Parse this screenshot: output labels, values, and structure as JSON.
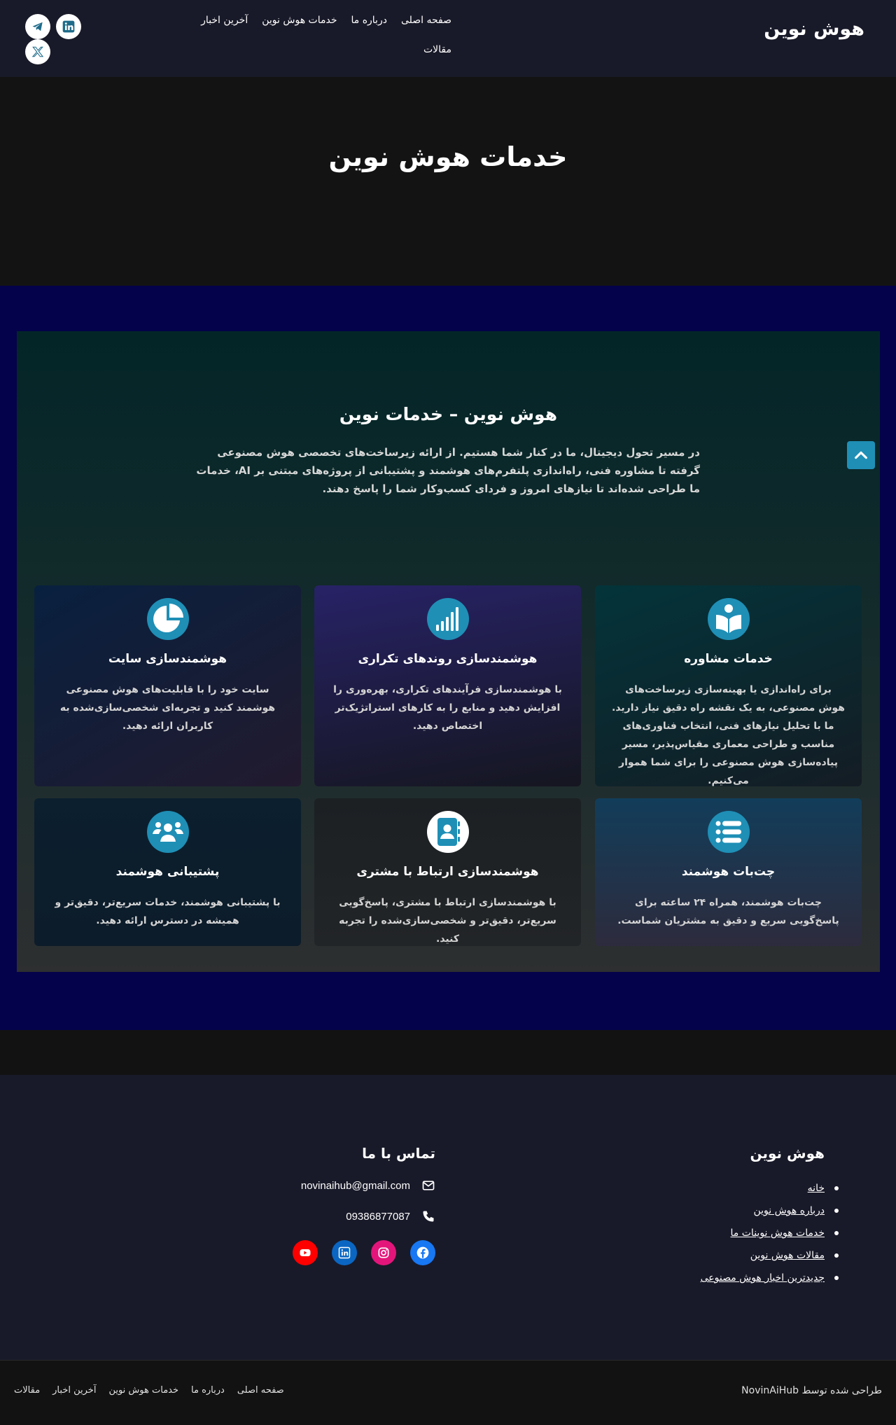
{
  "header": {
    "logo": "هوش نوین",
    "nav": [
      "صفحه اصلی",
      "درباره ما",
      "خدمات هوش نوین",
      "آخرین اخبار",
      "مقالات"
    ],
    "social_icons": [
      "telegram-icon",
      "linkedin-icon",
      "x-twitter-icon"
    ]
  },
  "hero": {
    "title": "خدمات هوش نوین"
  },
  "services": {
    "title": "هوش نوین – خدمات نوین",
    "intro": "در مسیر تحول دیجیتال، ما در کنار شما هستیم. از ارائه زیرساخت‌های تخصصی هوش مصنوعی گرفته تا مشاوره فنی، راه‌اندازی پلتفرم‌های هوشمند و پشتیبانی از پروژه‌های مبتنی بر AI، خدمات ما طراحی شده‌اند تا نیازهای امروز و فردای کسب‌وکار شما را پاسخ دهند.",
    "cards": [
      {
        "icon": "book-reader-icon",
        "title": "خدمات مشاوره",
        "text": "برای راه‌اندازی یا بهینه‌سازی زیرساخت‌های هوش مصنوعی، به یک نقشه راه دقیق نیاز دارید. ما با تحلیل نیازهای فنی، انتخاب فناوری‌های مناسب و طراحی معماری مقیاس‌پذیر، مسیر پیاده‌سازی هوش مصنوعی را برای شما هموار می‌کنیم."
      },
      {
        "icon": "signal-bars-icon",
        "title": "هوشمندسازی روندهای تکراری",
        "text": "با هوشمندسازی فرآیندهای تکراری، بهره‌وری را افزایش دهید و منابع را به کارهای استراتژیک‌تر اختصاص دهید."
      },
      {
        "icon": "pie-chart-icon",
        "title": "هوشمندسازی سایت",
        "text": "سایت خود را با قابلیت‌های هوش مصنوعی هوشمند کنید و تجربه‌ای شخصی‌سازی‌شده به کاربران ارائه دهید."
      },
      {
        "icon": "list-icon",
        "title": "چت‌بات هوشمند",
        "text": "چت‌بات هوشمند، همراه ۲۴ ساعته برای پاسخ‌گویی سریع و دقیق به مشتریان شماست."
      },
      {
        "icon": "address-book-icon",
        "title": "هوشمندسازی ارتباط با مشتری",
        "text": "با هوشمندسازی ارتباط با مشتری، پاسخ‌گویی سریع‌تر، دقیق‌تر و شخصی‌سازی‌شده را تجربه کنید."
      },
      {
        "icon": "users-icon",
        "title": "پشتیبانی هوشمند",
        "text": "با پشتیبانی هوشمند، خدمات سریع‌تر، دقیق‌تر و همیشه در دسترس ارائه دهید."
      }
    ]
  },
  "footer": {
    "brand": "هوش نوین",
    "links": [
      "خانه",
      "درباره هوش نوین",
      "خدمات هوش نوینات ما",
      "مقالات هوش نوین",
      "جدیدترین اخبار هوش مصنوعی"
    ],
    "contact_title": "تماس با ما",
    "email": "novinaihub@gmail.com",
    "phone": "09386877087",
    "social_icons": [
      "facebook-icon",
      "instagram-icon",
      "linkedin-icon",
      "youtube-icon"
    ]
  },
  "bottom_bar": {
    "credit": "طراحی شده توسط NovinAiHub",
    "nav": [
      "صفحه اصلی",
      "درباره ما",
      "خدمات هوش نوین",
      "آخرین اخبار",
      "مقالات"
    ]
  },
  "colors": {
    "header_bg": "#191a29",
    "services_bg": "#04024a",
    "accent": "#1f8fb6"
  }
}
